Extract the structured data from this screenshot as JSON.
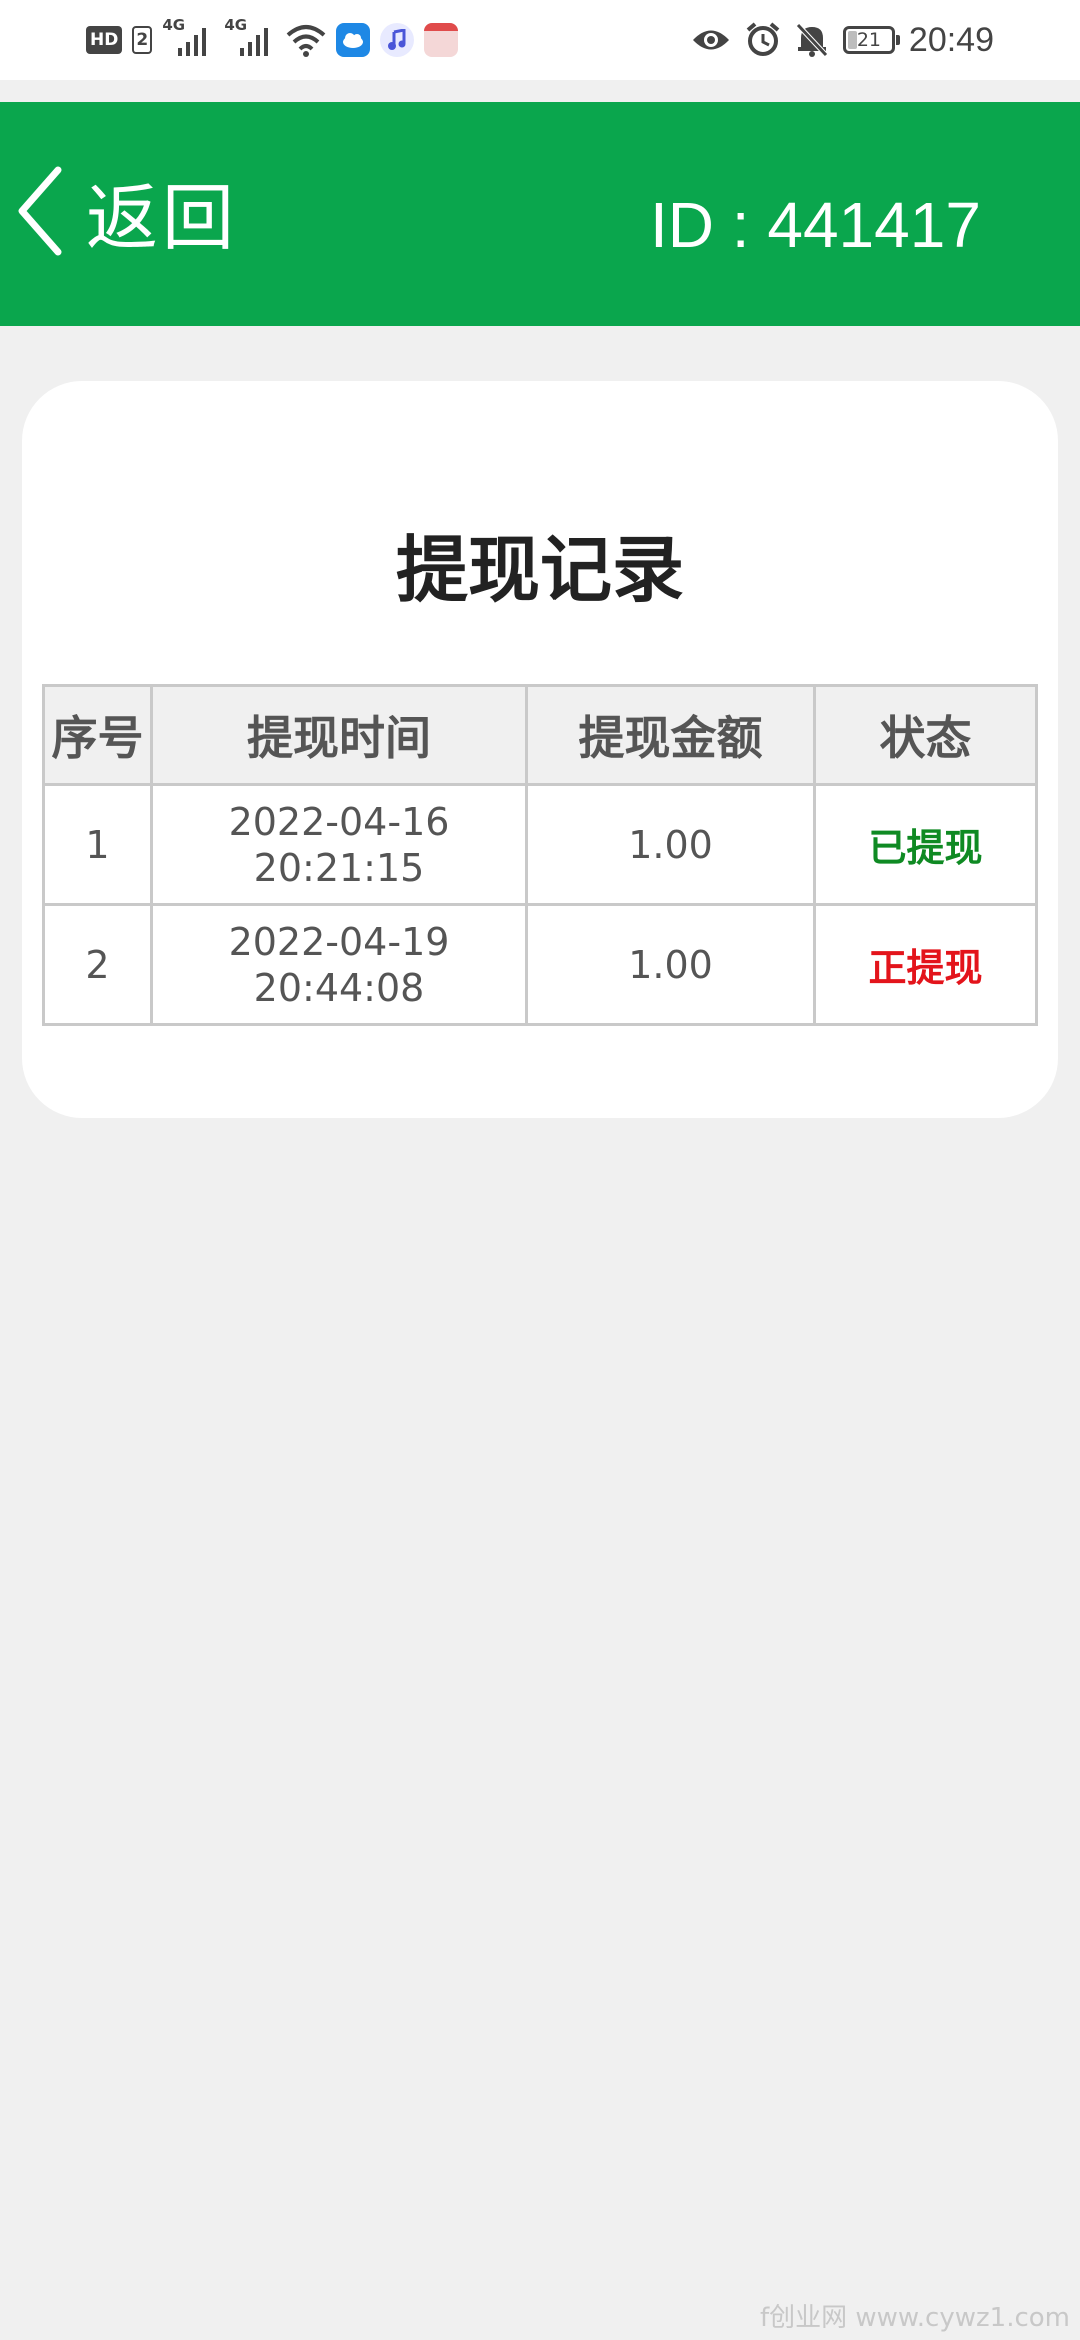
{
  "status_bar": {
    "hd": "HD",
    "sim": "2",
    "net1": "4G",
    "net2": "4G",
    "battery": "21",
    "battery_level": 0.21,
    "time": "20:49",
    "icons": [
      "hd-icon",
      "signal-icon",
      "signal-icon",
      "wifi-icon",
      "weather-app-icon",
      "music-app-icon",
      "app-icon",
      "eye-icon",
      "alarm-icon",
      "mute-icon",
      "battery-icon"
    ]
  },
  "header": {
    "back_label": "返回",
    "id_label": "ID : 441417",
    "color": "#0aa64d"
  },
  "card": {
    "title": "提现记录",
    "columns": [
      "序号",
      "提现时间",
      "提现金额",
      "状态"
    ],
    "rows": [
      {
        "index": "1",
        "date": "2022-04-16",
        "time": "20:21:15",
        "amount": "1.00",
        "status": "已提现",
        "status_color": "#0f8a23"
      },
      {
        "index": "2",
        "date": "2022-04-19",
        "time": "20:44:08",
        "amount": "1.00",
        "status": "正提现",
        "status_color": "#e3141b"
      }
    ]
  },
  "watermark": "f创业网 www.cywz1.com"
}
